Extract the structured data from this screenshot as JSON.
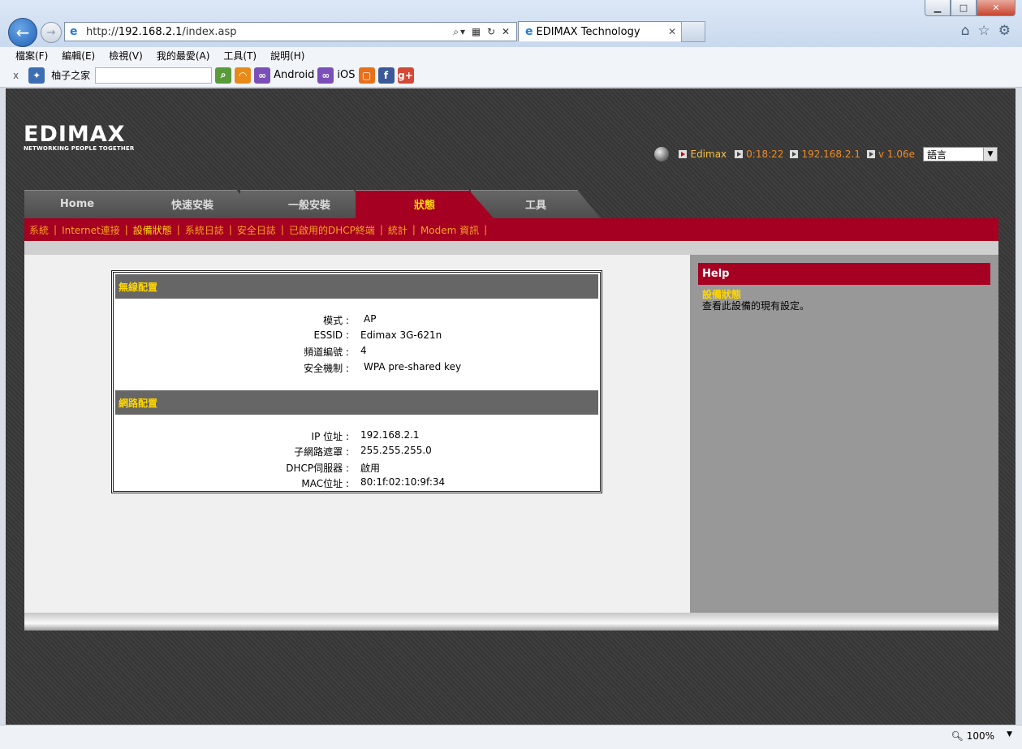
{
  "browser": {
    "url_prefix": "http://",
    "url_host": "192.168.2.1",
    "url_path": "/index.asp",
    "tab_title": "EDIMAX Technology",
    "menu": [
      "檔案(F)",
      "編輯(E)",
      "檢視(V)",
      "我的最愛(A)",
      "工具(T)",
      "說明(H)"
    ],
    "toolbar_site": "柚子之家",
    "toolbar_android": "Android",
    "toolbar_ios": "iOS",
    "zoom": "100%"
  },
  "logo": {
    "name": "EDIMAX",
    "tagline": "NETWORKING PEOPLE TOGETHER"
  },
  "status": {
    "model": "Edimax",
    "uptime": "0:18:22",
    "ip": "192.168.2.1",
    "version": "v 1.06e",
    "language": "語言"
  },
  "nav": {
    "tabs": [
      {
        "label": "Home"
      },
      {
        "label": "快速安裝"
      },
      {
        "label": "一般安裝"
      },
      {
        "label": "狀態"
      },
      {
        "label": "工具"
      }
    ],
    "sublinks": [
      "系統",
      "Internet連接",
      "設備狀態",
      "系統日誌",
      "安全日誌",
      "已啟用的DHCP終端",
      "統計",
      "Modem 資訊"
    ]
  },
  "wireless": {
    "title": "無線配置",
    "rows": [
      {
        "k": "模式 :",
        "v": "AP"
      },
      {
        "k": "ESSID :",
        "v": "Edimax 3G-621n"
      },
      {
        "k": "頻道編號 :",
        "v": "4"
      },
      {
        "k": "安全機制 :",
        "v": "WPA pre-shared key"
      }
    ]
  },
  "network": {
    "title": "網路配置",
    "rows": [
      {
        "k": "IP 位址 :",
        "v": "192.168.2.1"
      },
      {
        "k": "子網路遮罩 :",
        "v": "255.255.255.0"
      },
      {
        "k": "DHCP伺服器 :",
        "v": "啟用"
      },
      {
        "k": "MAC位址 :",
        "v": "80:1f:02:10:9f:34"
      }
    ]
  },
  "help": {
    "heading": "Help",
    "title": "設備狀態",
    "text": "查看此設備的現有設定。"
  },
  "colors": {
    "accent": "#a50021",
    "highlight": "#ffd700",
    "link": "#f7a21b"
  }
}
